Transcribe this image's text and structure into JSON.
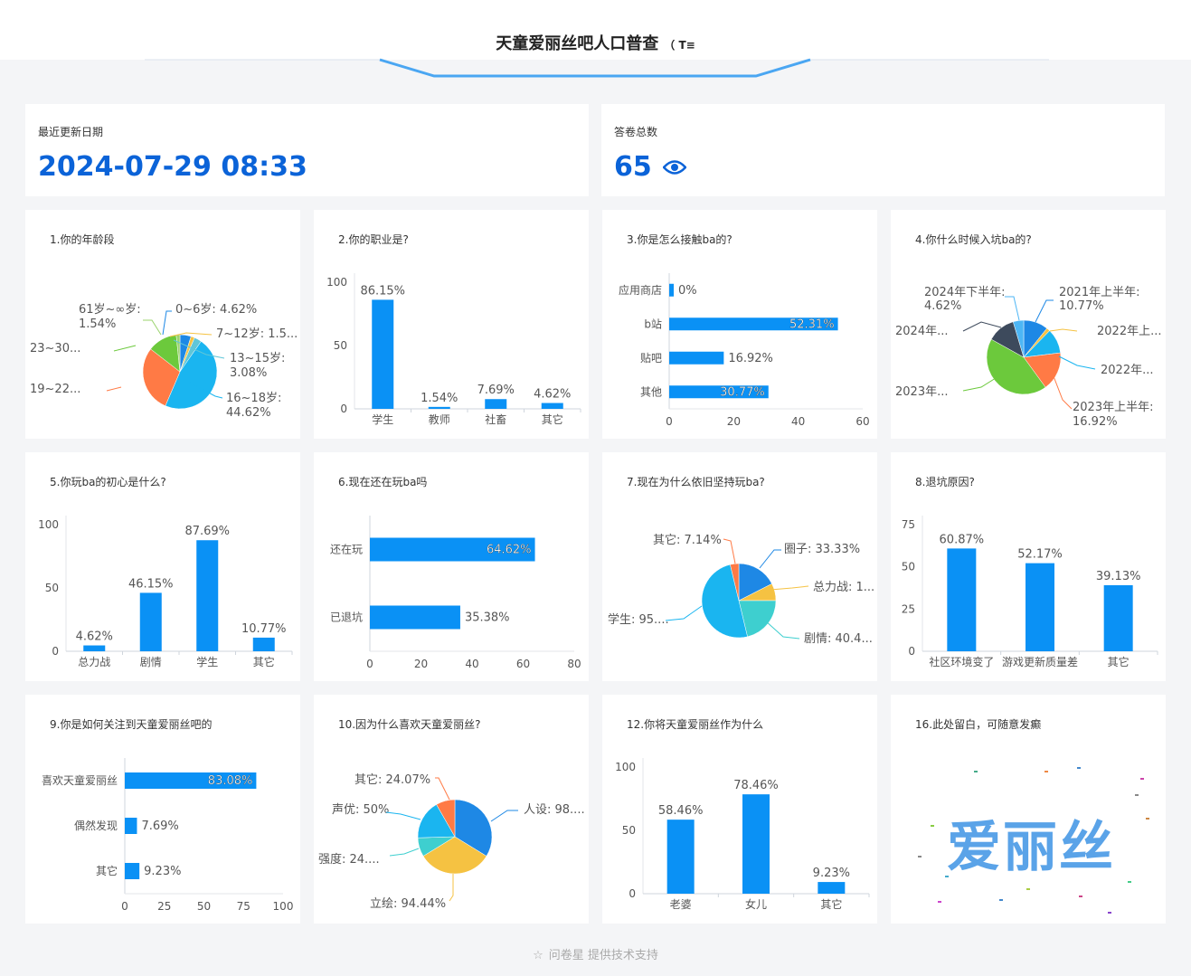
{
  "header": {
    "title": "天童爱丽丝吧人口普查",
    "title_suffix": "（ T≡"
  },
  "stats": {
    "update": {
      "label": "最近更新日期",
      "value": "2024-07-29 08:33"
    },
    "count": {
      "label": "答卷总数",
      "value": "65"
    }
  },
  "cards": [
    {
      "title": "1.你的年龄段"
    },
    {
      "title": "2.你的职业是?"
    },
    {
      "title": "3.你是怎么接触ba的?"
    },
    {
      "title": "4.你什么时候入坑ba的?"
    },
    {
      "title": "5.你玩ba的初心是什么?"
    },
    {
      "title": "6.现在还在玩ba吗"
    },
    {
      "title": "7.现在为什么依旧坚持玩ba?"
    },
    {
      "title": "8.退坑原因?"
    },
    {
      "title": "9.你是如何关注到天童爱丽丝吧的"
    },
    {
      "title": "10.因为什么喜欢天童爱丽丝?"
    },
    {
      "title": "12.你将天童爱丽丝作为什么"
    },
    {
      "title": "16.此处留白，可随意发癫"
    }
  ],
  "wordcloud": {
    "main_word": "爱丽丝"
  },
  "footer": {
    "text": "问卷星 提供技术支持"
  },
  "chart_data": [
    {
      "type": "pie",
      "labels": [
        "0~6岁: 4.62%",
        "7~12岁: 1.5...",
        "13~15岁:",
        "3.08%",
        "16~18岁:",
        "44.62%",
        "19~22...",
        "23~30...",
        "61岁~∞岁:",
        "1.54%"
      ],
      "slices": [
        {
          "color": "#1e88e5",
          "value": 4.62
        },
        {
          "color": "#f5c242",
          "value": 1.54
        },
        {
          "color": "#5fc6d8",
          "value": 3.08
        },
        {
          "color": "#1ab5f0",
          "value": 44.62
        },
        {
          "color": "#ff7a45",
          "value": 27.69
        },
        {
          "color": "#6cc93c",
          "value": 12.31
        },
        {
          "color": "#9bd36e",
          "value": 1.54
        }
      ]
    },
    {
      "type": "bar",
      "categories": [
        "学生",
        "教师",
        "社畜",
        "其它"
      ],
      "values": [
        86.15,
        1.54,
        7.69,
        4.62
      ],
      "value_labels": [
        "86.15%",
        "1.54%",
        "7.69%",
        "4.62%"
      ],
      "ylim": [
        0,
        100
      ],
      "yticks": [
        "0",
        "50",
        "100"
      ]
    },
    {
      "type": "bar-horizontal",
      "categories": [
        "应用商店",
        "b站",
        "贴吧",
        "其他"
      ],
      "values": [
        0,
        52.31,
        16.92,
        30.77
      ],
      "value_labels": [
        "0%",
        "52.31%",
        "16.92%",
        "30.77%"
      ],
      "xlim": [
        0,
        60
      ],
      "xticks": [
        "0",
        "20",
        "40",
        "60"
      ]
    },
    {
      "type": "pie",
      "labels": [
        "2024年下半年:",
        "4.62%",
        "2021年上半年:",
        "10.77%",
        "2022年上...",
        "2022年...",
        "2023年上半年:",
        "16.92%",
        "2023年...",
        "2024年..."
      ],
      "slices": [
        {
          "color": "#1e88e5",
          "value": 10.77
        },
        {
          "color": "#f5c242",
          "value": 1.54
        },
        {
          "color": "#1ab5f0",
          "value": 10.77
        },
        {
          "color": "#ff7a45",
          "value": 16.92
        },
        {
          "color": "#6cc93c",
          "value": 43.08
        },
        {
          "color": "#3d4a5c",
          "value": 12.31
        },
        {
          "color": "#4db6f5",
          "value": 4.62
        }
      ]
    },
    {
      "type": "bar",
      "categories": [
        "总力战",
        "剧情",
        "学生",
        "其它"
      ],
      "values": [
        4.62,
        46.15,
        87.69,
        10.77
      ],
      "value_labels": [
        "4.62%",
        "46.15%",
        "87.69%",
        "10.77%"
      ],
      "ylim": [
        0,
        100
      ],
      "yticks": [
        "0",
        "50",
        "100"
      ]
    },
    {
      "type": "bar-horizontal",
      "categories": [
        "还在玩",
        "已退坑"
      ],
      "values": [
        64.62,
        35.38
      ],
      "value_labels": [
        "64.62%",
        "35.38%"
      ],
      "xlim": [
        0,
        80
      ],
      "xticks": [
        "0",
        "20",
        "40",
        "60",
        "80"
      ]
    },
    {
      "type": "pie",
      "labels": [
        "其它: 7.14%",
        "圈子: 33.33%",
        "总力战: 1...",
        "剧情: 40.4...",
        "学生: 95...."
      ],
      "slices": [
        {
          "color": "#1e88e5",
          "value": 33.33
        },
        {
          "color": "#f5c242",
          "value": 14.29
        },
        {
          "color": "#3ecfcf",
          "value": 40.48
        },
        {
          "color": "#1ab5f0",
          "value": 95.24
        },
        {
          "color": "#ff7a45",
          "value": 7.14
        }
      ]
    },
    {
      "type": "bar",
      "categories": [
        "社区环境变了",
        "游戏更新质量差",
        "其它"
      ],
      "values": [
        60.87,
        52.17,
        39.13
      ],
      "value_labels": [
        "60.87%",
        "52.17%",
        "39.13%"
      ],
      "ylim": [
        0,
        75
      ],
      "yticks": [
        "0",
        "25",
        "50",
        "75"
      ]
    },
    {
      "type": "bar-horizontal",
      "categories": [
        "喜欢天童爱丽丝",
        "偶然发现",
        "其它"
      ],
      "values": [
        83.08,
        7.69,
        9.23
      ],
      "value_labels": [
        "83.08%",
        "7.69%",
        "9.23%"
      ],
      "xlim": [
        0,
        100
      ],
      "xticks": [
        "0",
        "25",
        "50",
        "75",
        "100"
      ]
    },
    {
      "type": "pie",
      "labels": [
        "其它: 24.07%",
        "人设: 98....",
        "声优: 50%",
        "强度: 24....",
        "立绘: 94.44%"
      ],
      "slices": [
        {
          "color": "#1e88e5",
          "value": 98.15
        },
        {
          "color": "#f5c242",
          "value": 94.44
        },
        {
          "color": "#3ecfcf",
          "value": 24.07
        },
        {
          "color": "#1ab5f0",
          "value": 50
        },
        {
          "color": "#ff7a45",
          "value": 24.07
        }
      ]
    },
    {
      "type": "bar",
      "categories": [
        "老婆",
        "女儿",
        "其它"
      ],
      "values": [
        58.46,
        78.46,
        9.23
      ],
      "value_labels": [
        "58.46%",
        "78.46%",
        "9.23%"
      ],
      "ylim": [
        0,
        100
      ],
      "yticks": [
        "0",
        "50",
        "100"
      ]
    }
  ]
}
